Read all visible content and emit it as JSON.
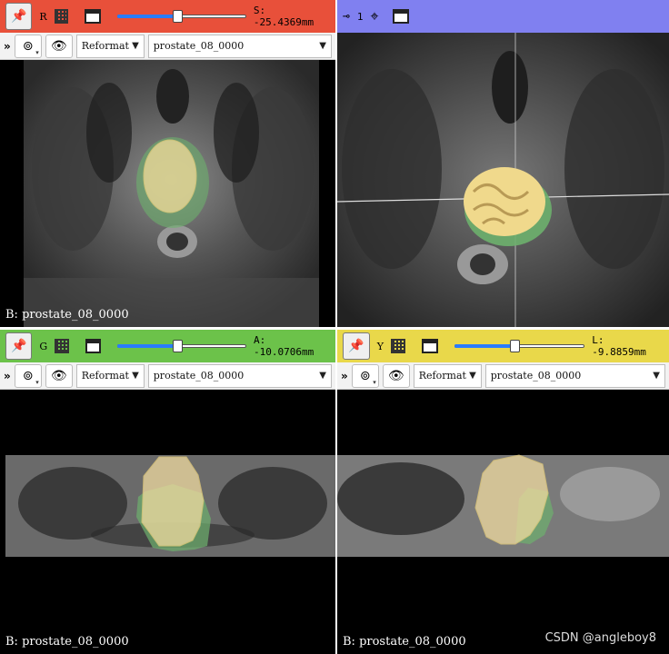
{
  "views": {
    "red": {
      "color": "#e8503a",
      "axis_letter": "R",
      "readout": "S: -25.4369mm",
      "slider_fraction": 0.47,
      "reformat_label": "Reformat",
      "volume": "prostate_08_0000",
      "caption": "B: prostate_08_0000"
    },
    "3d": {
      "color": "#8080f0",
      "number": "1"
    },
    "green": {
      "color": "#6cc24a",
      "axis_letter": "G",
      "readout": "A: -10.0706mm",
      "slider_fraction": 0.47,
      "reformat_label": "Reformat",
      "volume": "prostate_08_0000",
      "caption": "B: prostate_08_0000"
    },
    "yellow": {
      "color": "#e9d84a",
      "axis_letter": "Y",
      "readout": "L: -9.8859mm",
      "slider_fraction": 0.47,
      "reformat_label": "Reformat",
      "volume": "prostate_08_0000",
      "caption": "B: prostate_08_0000"
    }
  },
  "watermark": "CSDN @angleboy8"
}
